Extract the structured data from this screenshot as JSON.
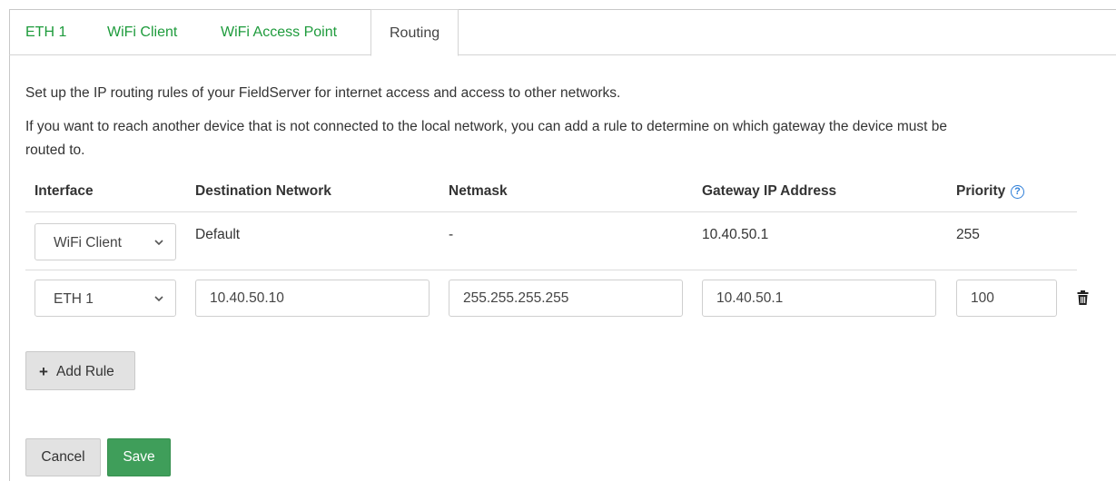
{
  "tabs": [
    {
      "label": "ETH 1"
    },
    {
      "label": "WiFi Client"
    },
    {
      "label": "WiFi Access Point"
    },
    {
      "label": "Routing",
      "active": true
    }
  ],
  "description": {
    "line1": "Set up the IP routing rules of your FieldServer for internet access and access to other networks.",
    "line2": "If you want to reach another device that is not connected to the local network, you can add a rule to determine on which gateway the device must be",
    "line3": "routed to."
  },
  "table": {
    "headers": {
      "interface": "Interface",
      "destination": "Destination Network",
      "netmask": "Netmask",
      "gateway": "Gateway IP Address",
      "priority": "Priority"
    },
    "help_icon_glyph": "?",
    "rows": [
      {
        "interface": "WiFi Client",
        "destination": "Default",
        "netmask": "-",
        "gateway": "10.40.50.1",
        "priority": "255"
      },
      {
        "interface": "ETH 1",
        "destination": "10.40.50.10",
        "netmask": "255.255.255.255",
        "gateway": "10.40.50.1",
        "priority": "100"
      }
    ]
  },
  "buttons": {
    "add_rule": "Add Rule",
    "add_rule_icon": "+",
    "cancel": "Cancel",
    "save": "Save"
  },
  "icons": {
    "help": "question-circle-icon",
    "delete": "trash-icon",
    "add": "plus-icon",
    "dropdown": "chevron-down-icon"
  },
  "colors": {
    "tab_link": "#1e9b3c",
    "save_button": "#3f9e5a",
    "help_icon": "#2f7fd8"
  }
}
